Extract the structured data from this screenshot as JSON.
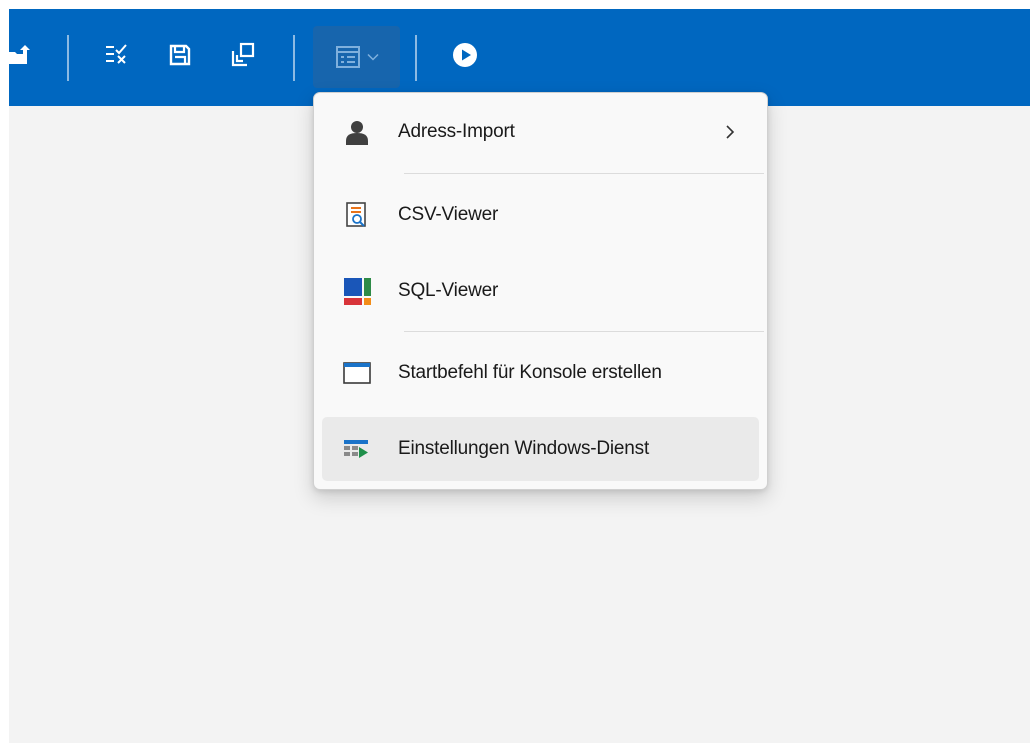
{
  "toolbar": {
    "accent_color": "#0067c0",
    "buttons": [
      {
        "icon": "folder-upload-icon"
      },
      {
        "icon": "checklist-cross-icon"
      },
      {
        "icon": "save-icon"
      },
      {
        "icon": "copy-window-icon"
      },
      {
        "icon": "window-list-dropdown-icon",
        "active": true
      },
      {
        "icon": "play-circle-icon"
      }
    ]
  },
  "menu": {
    "items": [
      {
        "label": "Adress-Import",
        "icon": "person-icon",
        "has_submenu": true
      },
      {
        "label": "CSV-Viewer",
        "icon": "csv-document-search-icon"
      },
      {
        "label": "SQL-Viewer",
        "icon": "sql-tiles-icon"
      },
      {
        "label": "Startbefehl für Konsole erstellen",
        "icon": "window-icon"
      },
      {
        "label": "Einstellungen Windows-Dienst",
        "icon": "service-settings-icon",
        "hovered": true
      }
    ]
  }
}
